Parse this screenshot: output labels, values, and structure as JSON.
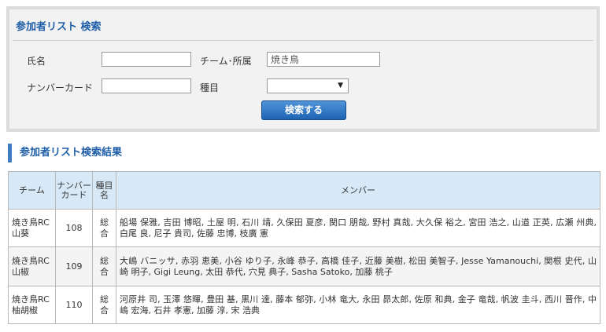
{
  "search": {
    "title": "参加者リスト 検索",
    "name_label": "氏名",
    "name_value": "",
    "team_label": "チーム･所属",
    "team_value": "焼き鳥",
    "card_label": "ナンバーカード",
    "card_value": "",
    "kind_label": "種目",
    "kind_value": "",
    "button_label": "検索する"
  },
  "results": {
    "heading": "参加者リスト検索結果",
    "columns": [
      "チーム",
      "ナンバーカード",
      "種目名",
      "メンバー"
    ],
    "rows": [
      {
        "team": "焼き鳥RC 山葵",
        "number": "108",
        "kind": "総合",
        "members": "船場 保雅, 吉田 博昭, 土屋 明, 石川 靖, 久保田 夏彦, 関口 朋哉, 野村 真哉, 大久保 裕之, 宮田 浩之, 山道 正英, 広瀬 州典, 白尾 良, 尼子 貴司, 佐藤 忠博, 枝廣 憲"
      },
      {
        "team": "焼き鳥RC 山椒",
        "number": "109",
        "kind": "総合",
        "members": "大嶋 バニッサ, 赤羽 恵美, 小谷 ゆり子, 永峰 恭子, 高橋 佳子, 近藤 美樹, 松田 美智子, Jesse Yamanouchi, 関根 史代, 山崎 明子, Gigi Leung, 太田 恭代, 穴見 典子, Sasha Satoko, 加藤 桃子"
      },
      {
        "team": "焼き鳥RC 柚胡椒",
        "number": "110",
        "kind": "総合",
        "members": "河原井 司, 玉澤 悠暉, 豊田 基, 黒川 達, 藤本 郁弥, 小林 竜大, 永田 昴太郎, 佐原 和典, 金子 竜哉, 帆波 圭斗, 西川 晋作, 中嶋 宏海, 石井 孝憲, 加藤 淳, 宋 浩典"
      }
    ]
  }
}
